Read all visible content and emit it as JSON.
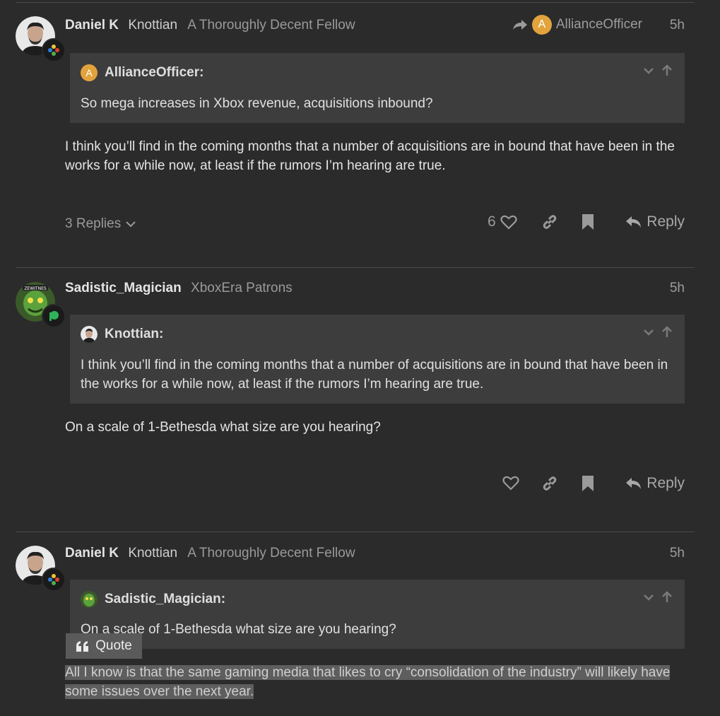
{
  "posts": [
    {
      "fullname": "Daniel K",
      "username": "Knottian",
      "usertitle": "A Thoroughly Decent Fellow",
      "reply_to": "AllianceOfficer",
      "reply_to_initial": "A",
      "date": "5h",
      "quote": {
        "author": "AllianceOfficer:",
        "author_initial": "A",
        "text": "So mega increases in Xbox revenue, acquisitions inbound?"
      },
      "body": "I think you’ll find in the coming months that a number of acquisitions are in bound that have been in the works for a while now, at least if the rumors I’m hearing are true.",
      "replies_label": "3 Replies",
      "like_count": "6",
      "reply_label": "Reply"
    },
    {
      "fullname": "Sadistic_Magician",
      "usertitle": "XboxEra Patrons",
      "date": "5h",
      "quote": {
        "author": "Knottian:",
        "text": "I think you’ll find in the coming months that a number of acquisitions are in bound that have been in the works for a while now, at least if the rumors I’m hearing are true."
      },
      "body": "On a scale of 1-Bethesda what size are you hearing?",
      "reply_label": "Reply"
    },
    {
      "fullname": "Daniel K",
      "username": "Knottian",
      "usertitle": "A Thoroughly Decent Fellow",
      "date": "5h",
      "quote": {
        "author": "Sadistic_Magician:",
        "text": "On a scale of 1-Bethesda what size are you hearing?"
      },
      "quote_button": "Quote",
      "body_line1": "All I know is that the same gaming media that likes to cry “consolidation of the industry” will likely have",
      "body_line2": "some issues over the next year."
    }
  ],
  "colors": {
    "background": "#2b2b2b",
    "quote_background": "#3d3d3d",
    "alliance_avatar": "#e2a33d",
    "selection": "#5e5e5e"
  }
}
